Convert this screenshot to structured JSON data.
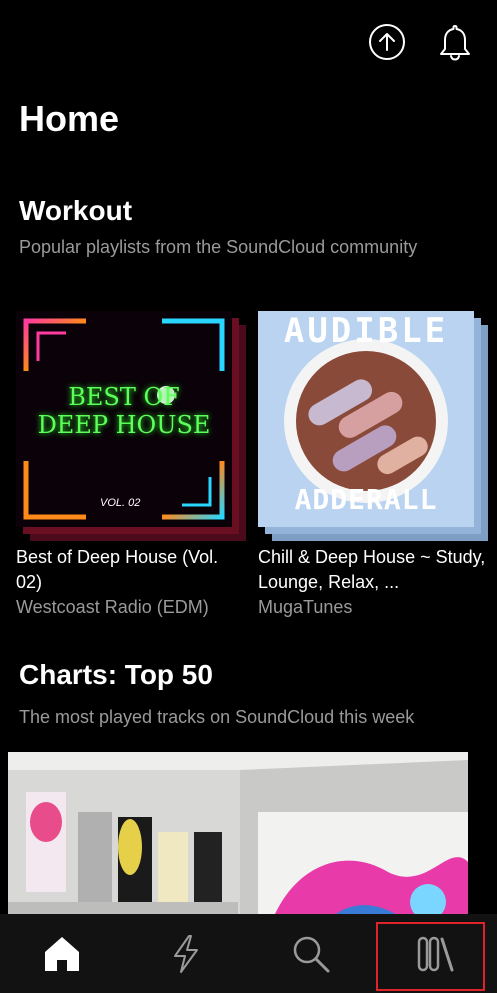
{
  "header": {
    "title": "Home",
    "upload_icon": "upload-icon",
    "notification_icon": "bell-icon"
  },
  "workout": {
    "title": "Workout",
    "subtitle": "Popular playlists from the SoundCloud community",
    "cards": [
      {
        "title": "Best of Deep House (Vol. 02)",
        "artist": "Westcoast Radio (EDM)",
        "art_text": "BEST OF DEEP HOUSE",
        "art_vol": "VOL. 02"
      },
      {
        "title": "Chill & Deep House ~ Study, Lounge, Relax, ...",
        "artist": "MugaTunes",
        "art_top": "AUDIBLE",
        "art_bottom": "ADDERALL"
      }
    ]
  },
  "charts": {
    "title": "Charts: Top 50",
    "subtitle": "The most played tracks on SoundCloud this week"
  },
  "nav": {
    "items": [
      {
        "name": "home",
        "icon": "home-icon",
        "active": true
      },
      {
        "name": "feed",
        "icon": "lightning-icon",
        "active": false
      },
      {
        "name": "search",
        "icon": "search-icon",
        "active": false
      },
      {
        "name": "library",
        "icon": "library-icon",
        "active": false,
        "highlighted": true
      }
    ]
  },
  "colors": {
    "background": "#000000",
    "nav_background": "#121212",
    "secondary_text": "#9a9a9a",
    "highlight_border": "#e0222a"
  }
}
